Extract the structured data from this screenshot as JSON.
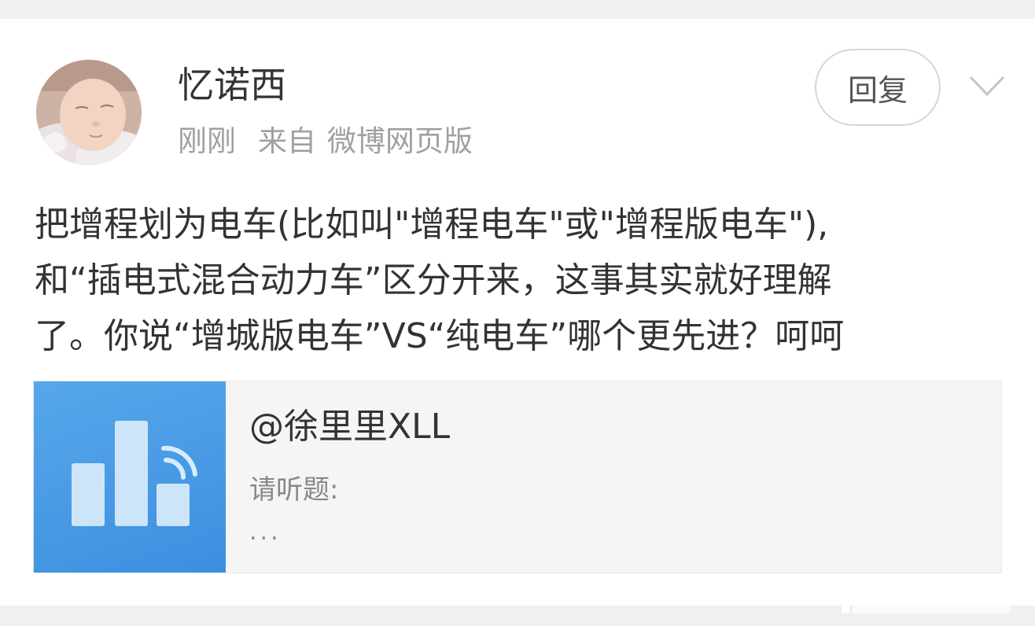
{
  "post": {
    "username": "忆诺西",
    "time": "刚刚",
    "source_prefix": "来自",
    "source": "微博网页版",
    "reply_label": "回复",
    "text_lines": [
      "把增程划为电车(比如叫\"增程电车\"或\"增程版电车\"),",
      "和“插电式混合动力车”区分开来，这事其实就好理解",
      "了。你说“增城版电车”VS“纯电车”哪个更先进？呵呵"
    ]
  },
  "quote": {
    "author": "@徐里里XLL",
    "title": "请听题:",
    "ellipsis": "..."
  },
  "colors": {
    "thumb_blue": "#4a9be6",
    "text_primary": "#333333",
    "text_secondary": "#a0a0a0"
  },
  "icons": {
    "more": "chevron-down-icon",
    "thumb": "bar-chart-signal-icon"
  }
}
